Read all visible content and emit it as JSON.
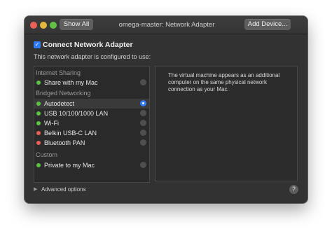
{
  "window": {
    "title": "omega-master: Network Adapter",
    "show_all_label": "Show All",
    "add_device_label": "Add Device..."
  },
  "connect": {
    "label": "Connect Network Adapter",
    "checked": true
  },
  "subtitle": "This network adapter is configured to use:",
  "groups": [
    {
      "header": "Internet Sharing",
      "items": [
        {
          "label": "Share with my Mac",
          "status_color": "#5fc245",
          "selected": false
        }
      ]
    },
    {
      "header": "Bridged Networking",
      "items": [
        {
          "label": "Autodetect",
          "status_color": "#5fc245",
          "selected": true
        },
        {
          "label": "USB 10/100/1000 LAN",
          "status_color": "#5fc245",
          "selected": false
        },
        {
          "label": "Wi-Fi",
          "status_color": "#5fc245",
          "selected": false
        },
        {
          "label": "Belkin USB-C LAN",
          "status_color": "#ec5f57",
          "selected": false
        },
        {
          "label": "Bluetooth PAN",
          "status_color": "#ec5f57",
          "selected": false
        }
      ]
    },
    {
      "header": "Custom",
      "items": [
        {
          "label": "Private to my Mac",
          "status_color": "#5fc245",
          "selected": false
        }
      ]
    }
  ],
  "description": "The virtual machine appears as an additional computer on the same physical network connection as your Mac.",
  "advanced_options_label": "Advanced options",
  "help_label": "?",
  "colors": {
    "accent": "#2f7bf5",
    "status_on": "#5fc245",
    "status_off": "#ec5f57"
  }
}
